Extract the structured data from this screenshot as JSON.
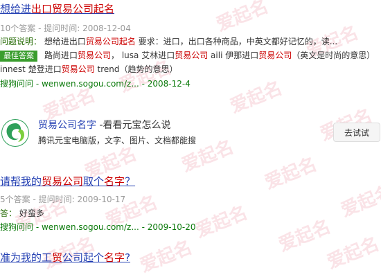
{
  "results": [
    {
      "title_parts": [
        "想给进",
        "出口",
        "贸易公司起名",
        ""
      ],
      "meta": "10个答案 - 提问时间: 2008-12-04",
      "desc_label": "问题说明：",
      "desc_parts": [
        "想给进出口",
        "贸易公司起名",
        " 要求：进口，出口各种商品，中英文都好记忆的，读..."
      ],
      "best_badge": "最佳答案",
      "answer_parts": [
        "路尚进口",
        "贸易公司",
        "， lusa 艾林进口",
        "贸易公司",
        " aili 伊那进口",
        "贸易公司",
        "（英文是时尚的意思） innest 楚登进口",
        "贸易公司",
        " trend（趋势的意思）"
      ],
      "source_brand": "搜狗问问",
      "source_rest": " - wenwen.sogou.com/z... - 2008-12-4"
    },
    {
      "title_parts": [
        "请帮我的",
        "贸易公司",
        "取个",
        "名字",
        "？"
      ],
      "meta": "5个答案 - 提问时间: 2009-10-17",
      "answer_label": "答：",
      "answer_text": "好蛮多",
      "source_brand": "搜狗问问",
      "source_rest": " - wenwen.sogou.com/z... - 2009-10-20"
    },
    {
      "title_parts": [
        "准为我的工",
        "贸",
        "公司起个",
        "名字",
        "?"
      ]
    }
  ],
  "ad": {
    "title_highlight": "贸易公司名字",
    "title_rest": " -看看元宝怎么说",
    "subtitle": "腾讯元宝电脑版，文字、图片、文档都能搜",
    "button": "去试试",
    "logo_icon": "yuanbao-logo-icon",
    "brand_color": "#2fa05a"
  },
  "watermark": "爱起名"
}
